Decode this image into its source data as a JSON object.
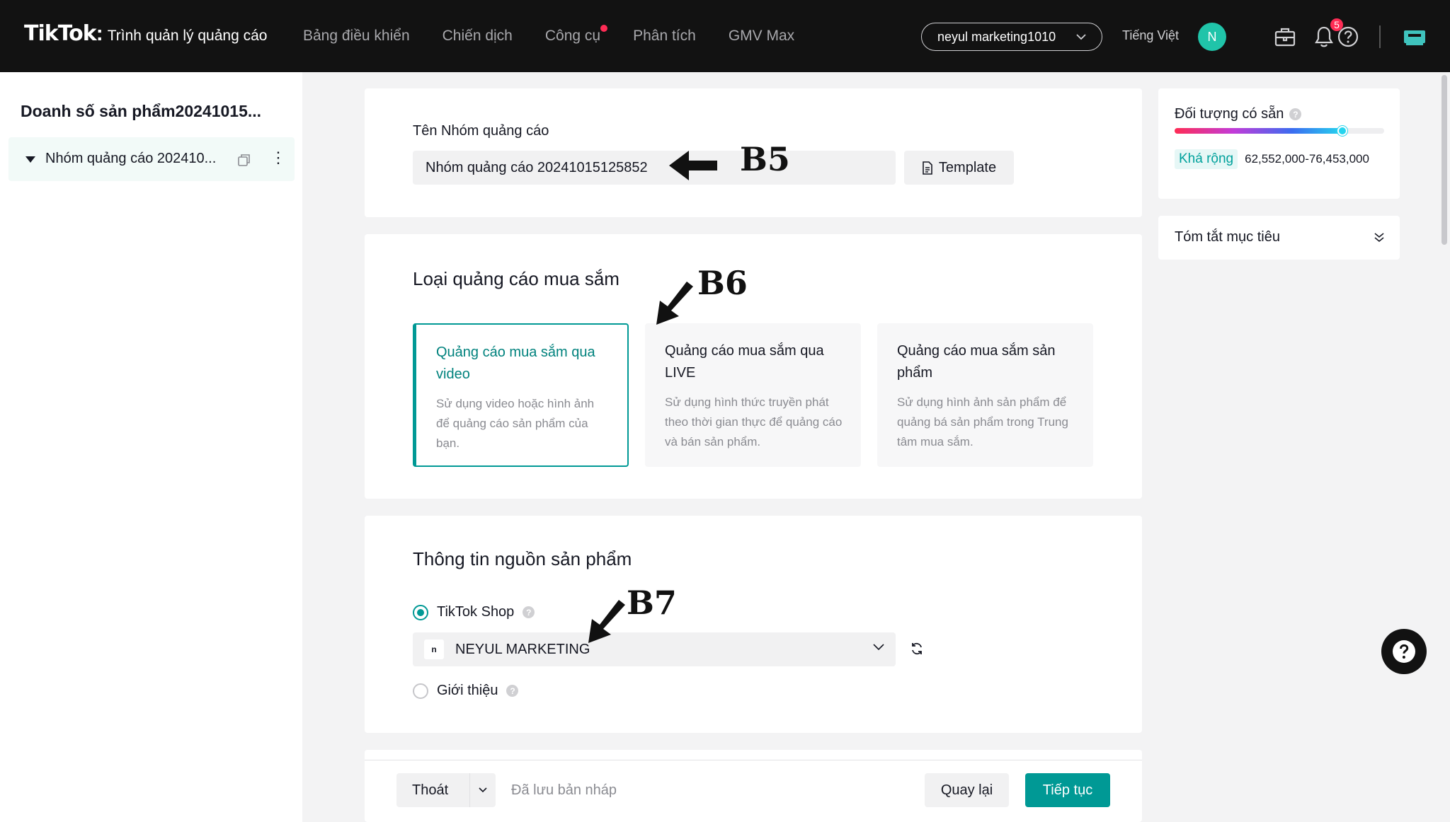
{
  "header": {
    "logo": "TikTok",
    "logo_separator": ":",
    "product_name": "Trình quản lý quảng cáo",
    "nav": [
      "Bảng điều khiển",
      "Chiến dịch",
      "Công cụ",
      "Phân tích",
      "GMV Max"
    ],
    "account": "neyul marketing1010",
    "language": "Tiếng Việt",
    "avatar_initial": "N",
    "notification_count": "5"
  },
  "sidebar": {
    "campaign_title": "Doanh số sản phẩm20241015...",
    "adgroup_label": "Nhóm quảng cáo 202410...",
    "more_glyph": "⋮"
  },
  "adgroup": {
    "name_label": "Tên Nhóm quảng cáo",
    "name_value": "Nhóm quảng cáo 20241015125852",
    "template_label": "Template"
  },
  "shopping_type": {
    "title": "Loại quảng cáo mua sắm",
    "options": [
      {
        "title": "Quảng cáo mua sắm qua video",
        "desc": "Sử dụng video hoặc hình ảnh để quảng cáo sản phẩm của bạn.",
        "selected": true
      },
      {
        "title": "Quảng cáo mua sắm qua LIVE",
        "desc": "Sử dụng hình thức truyền phát theo thời gian thực để quảng cáo và bán sản phẩm.",
        "selected": false
      },
      {
        "title": "Quảng cáo mua sắm sản phẩm",
        "desc": "Sử dụng hình ảnh sản phẩm để quảng bá sản phẩm trong Trung tâm mua sắm.",
        "selected": false
      }
    ]
  },
  "product_source": {
    "title": "Thông tin nguồn sản phẩm",
    "option_shop": "TikTok Shop",
    "shop_logo_text": "n",
    "shop_value": "NEYUL MARKETING",
    "option_showcase": "Giới thiệu",
    "help_glyph": "?"
  },
  "footer": {
    "exit_label": "Thoát",
    "draft_status": "Đã lưu bản nháp",
    "back_label": "Quay lại",
    "next_label": "Tiếp tục"
  },
  "audience": {
    "title": "Đối tượng có sẵn",
    "level_fraction": 0.8,
    "badge": "Khá rộng",
    "range": "62,552,000-76,453,000"
  },
  "summary": {
    "title": "Tóm tắt mục tiêu"
  },
  "annotations": [
    "B5",
    "B6",
    "B7"
  ],
  "colors": {
    "accent": "#009995",
    "topbar": "#121212",
    "alert": "#fe2c55"
  }
}
